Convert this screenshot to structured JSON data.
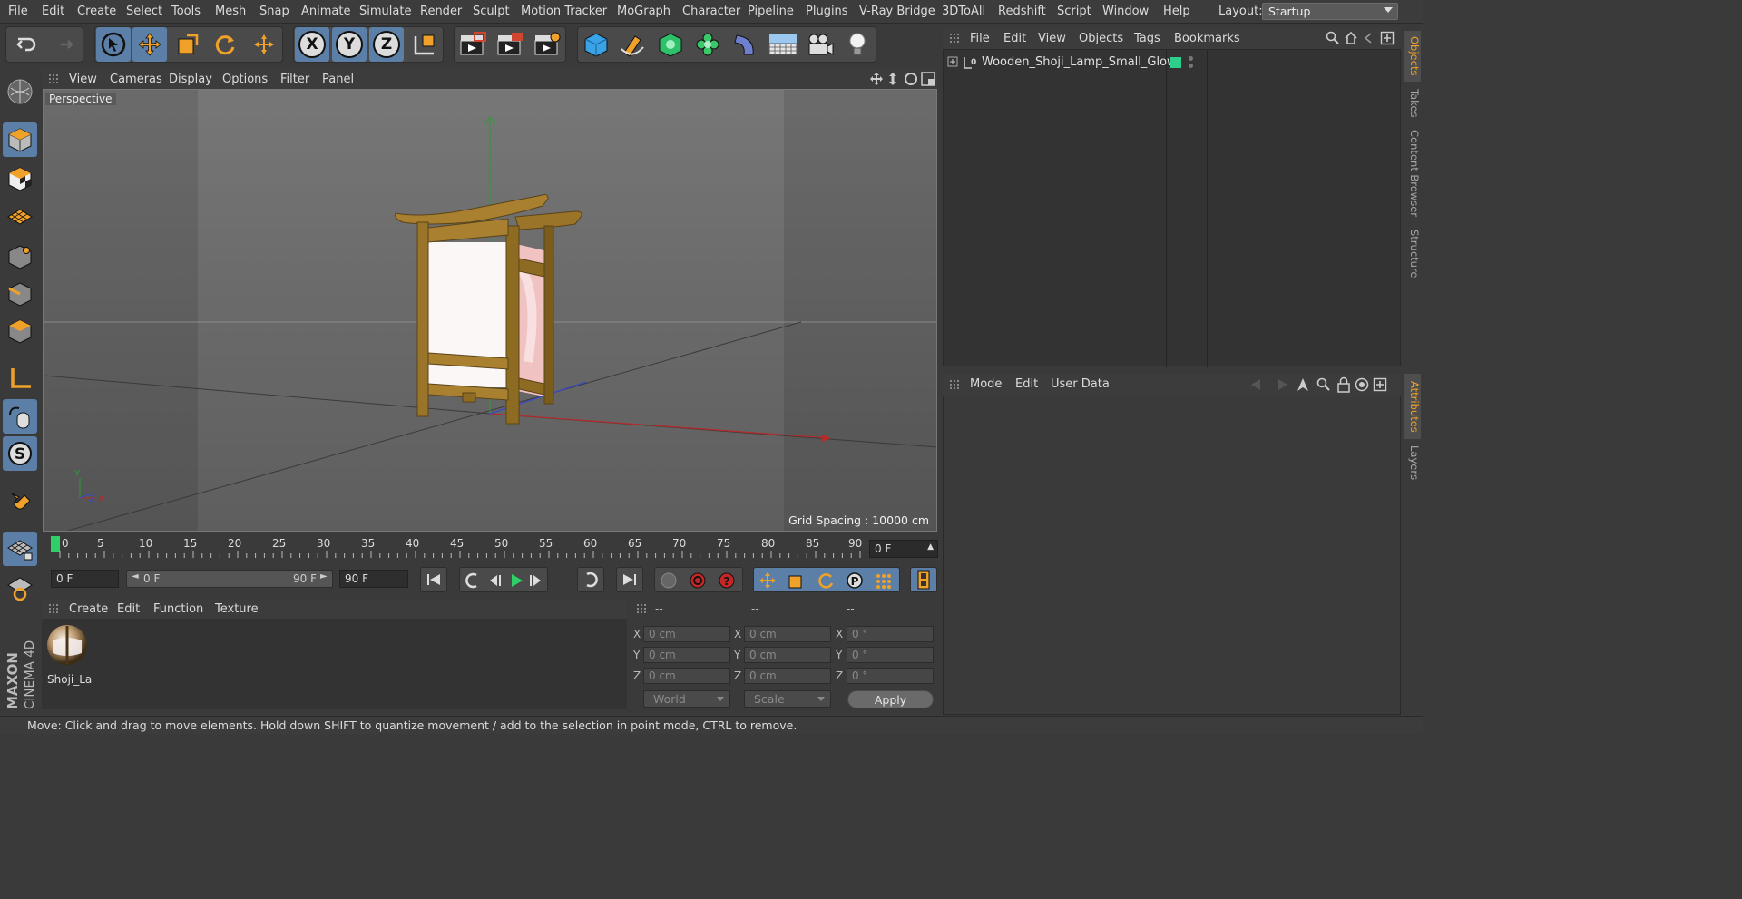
{
  "menubar": {
    "items": [
      "File",
      "Edit",
      "Create",
      "Select",
      "Tools",
      "Mesh",
      "Snap",
      "Animate",
      "Simulate",
      "Render",
      "Sculpt",
      "Motion Tracker",
      "MoGraph",
      "Character",
      "Pipeline",
      "Plugins",
      "V-Ray Bridge",
      "3DToAll",
      "Redshift",
      "Script",
      "Window",
      "Help"
    ],
    "layout_label": "Layout:",
    "layout_value": "Startup"
  },
  "toolbar": {
    "axis_x": "X",
    "axis_y": "Y",
    "axis_z": "Z"
  },
  "viewport": {
    "menu": [
      "View",
      "Cameras",
      "Display",
      "Options",
      "Filter",
      "Panel"
    ],
    "label": "Perspective",
    "grid_spacing": "Grid Spacing : 10000 cm",
    "mini_axis_y": "Y",
    "mini_axis_z": "Z",
    "mini_axis_x": "X"
  },
  "timeline": {
    "ticks": [
      "0",
      "5",
      "10",
      "15",
      "20",
      "25",
      "30",
      "35",
      "40",
      "45",
      "50",
      "55",
      "60",
      "65",
      "70",
      "75",
      "80",
      "85",
      "90"
    ],
    "current_frame": "0 F",
    "start_field": "0 F",
    "range_start": "0 F",
    "range_end": "90 F",
    "end_field": "90 F"
  },
  "material_manager": {
    "menu": [
      "Create",
      "Edit",
      "Function",
      "Texture"
    ],
    "materials": [
      {
        "name": "Shoji_La"
      }
    ]
  },
  "coordinates": {
    "headers": [
      "--",
      "--",
      "--"
    ],
    "rows": [
      {
        "l1": "X",
        "v1": "0 cm",
        "l2": "X",
        "v2": "0 cm",
        "l3": "X",
        "v3": "0 °"
      },
      {
        "l1": "Y",
        "v1": "0 cm",
        "l2": "Y",
        "v2": "0 cm",
        "l3": "Y",
        "v3": "0 °"
      },
      {
        "l1": "Z",
        "v1": "0 cm",
        "l2": "Z",
        "v2": "0 cm",
        "l3": "Z",
        "v3": "0 °"
      }
    ],
    "mode_select": "World",
    "size_select": "Scale",
    "apply": "Apply"
  },
  "object_manager": {
    "menu": [
      "File",
      "Edit",
      "View",
      "Objects",
      "Tags",
      "Bookmarks"
    ],
    "objects": [
      {
        "name": "Wooden_Shoji_Lamp_Small_Glow",
        "layer_color": "#2ecf8a"
      }
    ]
  },
  "attribute_manager": {
    "menu": [
      "Mode",
      "Edit",
      "User Data"
    ]
  },
  "right_tabs": {
    "top": [
      "Objects",
      "Takes",
      "Content Browser",
      "Structure"
    ],
    "bottom": [
      "Attributes",
      "Layers"
    ]
  },
  "logo": {
    "line1": "MAXON",
    "line2": "CINEMA 4D"
  },
  "status": {
    "text": "Move: Click and drag to move elements. Hold down SHIFT to quantize movement / add to the selection in point mode, CTRL to remove."
  },
  "colors": {
    "accent": "#5b7fa6",
    "orange": "#f0a12a",
    "play": "#2fcf6a"
  }
}
